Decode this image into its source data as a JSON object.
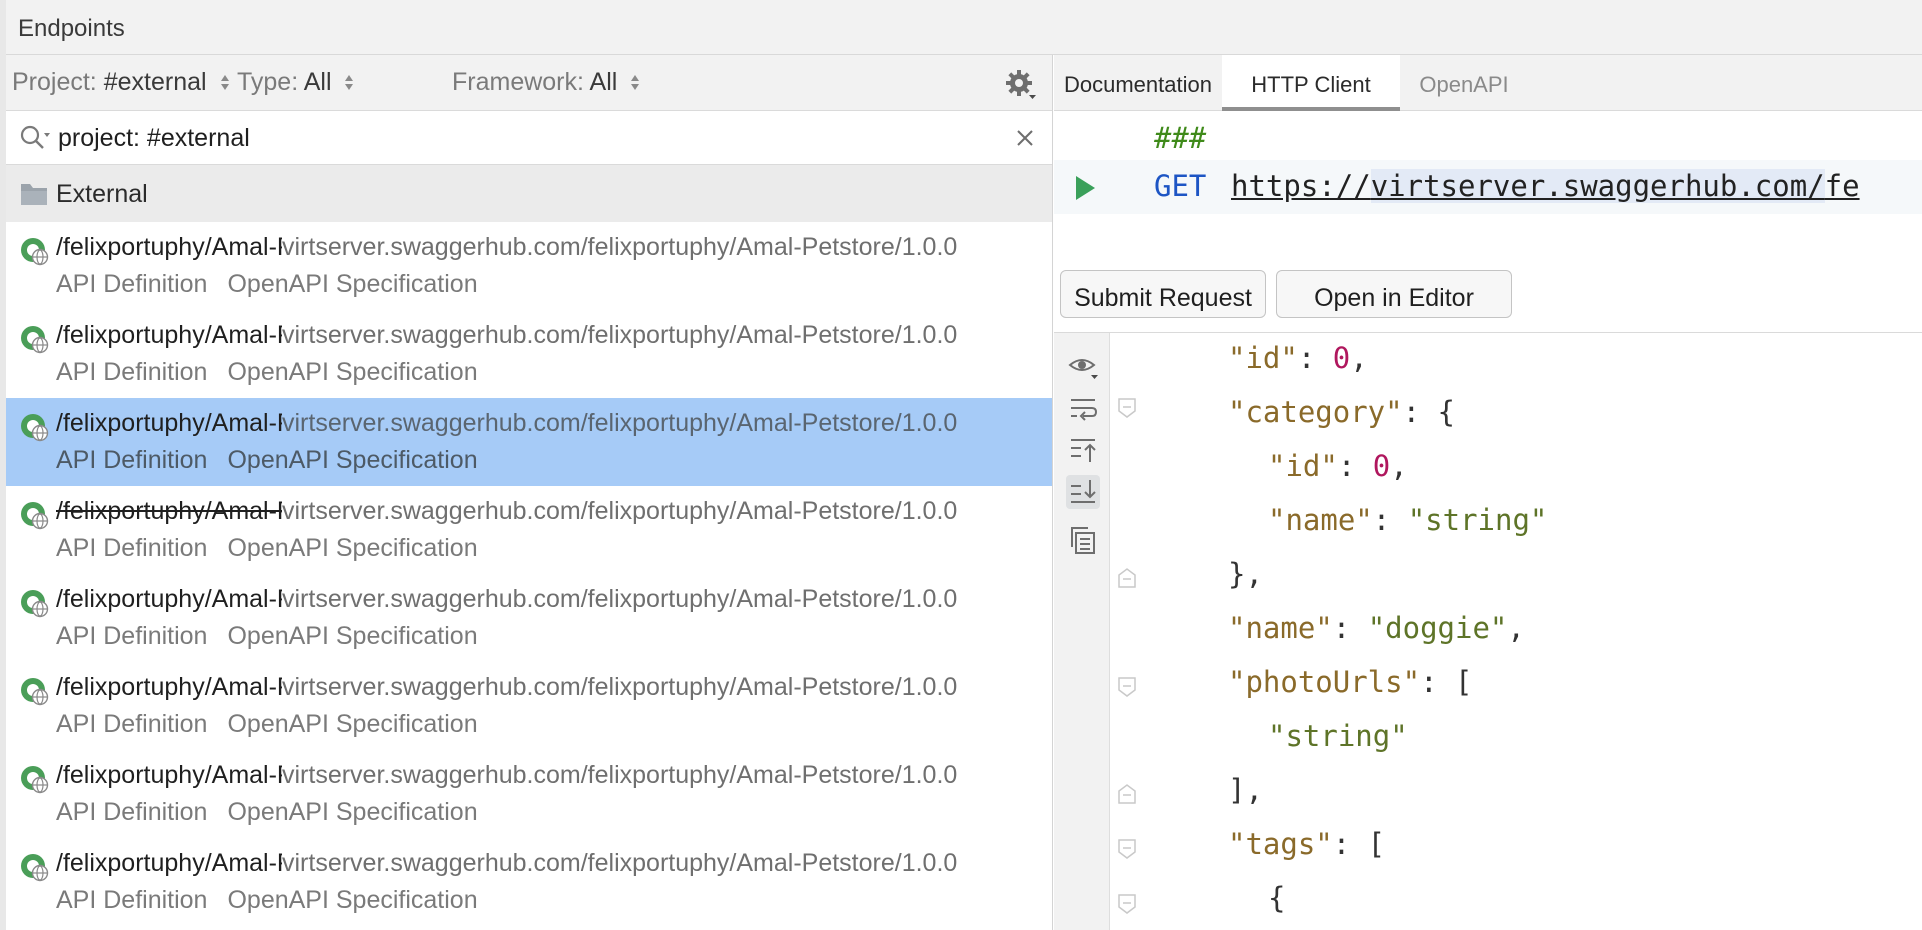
{
  "window": {
    "title": "Endpoints"
  },
  "filters": {
    "project_label": "Project:",
    "project_value": "#external",
    "type_label": "Type:",
    "type_value": "All",
    "framework_label": "Framework:",
    "framework_value": "All"
  },
  "search": {
    "value": "project: #external"
  },
  "group": {
    "name": "External"
  },
  "endpoints": [
    {
      "path": "/felixportuphy/Amal-Petstore",
      "url": "virtserver.swaggerhub.com/felixportuphy/Amal-Petstore/1.0.0",
      "type": "API Definition",
      "spec": "OpenAPI Specification"
    },
    {
      "path": "/felixportuphy/Amal-Petstore",
      "url": "virtserver.swaggerhub.com/felixportuphy/Amal-Petstore/1.0.0",
      "type": "API Definition",
      "spec": "OpenAPI Specification"
    },
    {
      "path": "/felixportuphy/Amal-Petstore",
      "url": "virtserver.swaggerhub.com/felixportuphy/Amal-Petstore/1.0.0",
      "type": "API Definition",
      "spec": "OpenAPI Specification"
    },
    {
      "path": "/felixportuphy/Amal-Petstore",
      "url": "virtserver.swaggerhub.com/felixportuphy/Amal-Petstore/1.0.0",
      "type": "API Definition",
      "spec": "OpenAPI Specification"
    },
    {
      "path": "/felixportuphy/Amal-Petstore",
      "url": "virtserver.swaggerhub.com/felixportuphy/Amal-Petstore/1.0.0",
      "type": "API Definition",
      "spec": "OpenAPI Specification"
    },
    {
      "path": "/felixportuphy/Amal-Petstore",
      "url": "virtserver.swaggerhub.com/felixportuphy/Amal-Petstore/1.0.0",
      "type": "API Definition",
      "spec": "OpenAPI Specification"
    },
    {
      "path": "/felixportuphy/Amal-Petstore",
      "url": "virtserver.swaggerhub.com/felixportuphy/Amal-Petstore/1.0.0",
      "type": "API Definition",
      "spec": "OpenAPI Specification"
    },
    {
      "path": "/felixportuphy/Amal-Petstore",
      "url": "virtserver.swaggerhub.com/felixportuphy/Amal-Petstore/1.0.0",
      "type": "API Definition",
      "spec": "OpenAPI Specification"
    }
  ],
  "selected_index": 2,
  "deprecated_index": 3,
  "tabs": [
    {
      "label": "Documentation"
    },
    {
      "label": "HTTP Client"
    },
    {
      "label": "OpenAPI"
    }
  ],
  "active_tab": 1,
  "request": {
    "separator": "###",
    "method": "GET",
    "url_prefix": "https://",
    "url_host": "virtserver.swaggerhub.com/",
    "url_rest": "fe"
  },
  "buttons": {
    "submit": "Submit Request",
    "open_editor": "Open in Editor"
  },
  "response_lines": [
    [
      [
        "k",
        "\"id\""
      ],
      [
        "p",
        ": "
      ],
      [
        "n",
        "0"
      ],
      [
        "p",
        ","
      ]
    ],
    [
      [
        "k",
        "\"category\""
      ],
      [
        "p",
        ": {"
      ]
    ],
    [
      [
        "k",
        "\"id\""
      ],
      [
        "p",
        ": "
      ],
      [
        "n",
        "0"
      ],
      [
        "p",
        ","
      ]
    ],
    [
      [
        "k",
        "\"name\""
      ],
      [
        "p",
        ": "
      ],
      [
        "s",
        "\"string\""
      ]
    ],
    [
      [
        "p",
        "},"
      ]
    ],
    [
      [
        "k",
        "\"name\""
      ],
      [
        "p",
        ": "
      ],
      [
        "s",
        "\"doggie\""
      ],
      [
        "p",
        ","
      ]
    ],
    [
      [
        "k",
        "\"photoUrls\""
      ],
      [
        "p",
        ": ["
      ]
    ],
    [
      [
        "s",
        "\"string\""
      ]
    ],
    [
      [
        "p",
        "],"
      ]
    ],
    [
      [
        "k",
        "\"tags\""
      ],
      [
        "p",
        ": ["
      ]
    ],
    [
      [
        "p",
        "{"
      ]
    ]
  ],
  "icons": {
    "gear": "gear-icon",
    "search": "search-icon",
    "clear": "close-icon",
    "folder": "folder-icon",
    "endpoint": "web-endpoint-icon",
    "run": "run-icon",
    "preview": "eye-icon",
    "wrap": "soft-wrap-icon",
    "scroll_top": "scroll-to-top-icon",
    "scroll_end": "scroll-to-end-icon",
    "copy": "copy-icon"
  },
  "colors": {
    "selection": "#a6cbf7",
    "keyword_method": "#1d55c4",
    "comment": "#3f8a1a",
    "json_key": "#8a6a2a",
    "json_string": "#5e7428",
    "json_number": "#b0175e",
    "run_green": "#3aa05a"
  }
}
